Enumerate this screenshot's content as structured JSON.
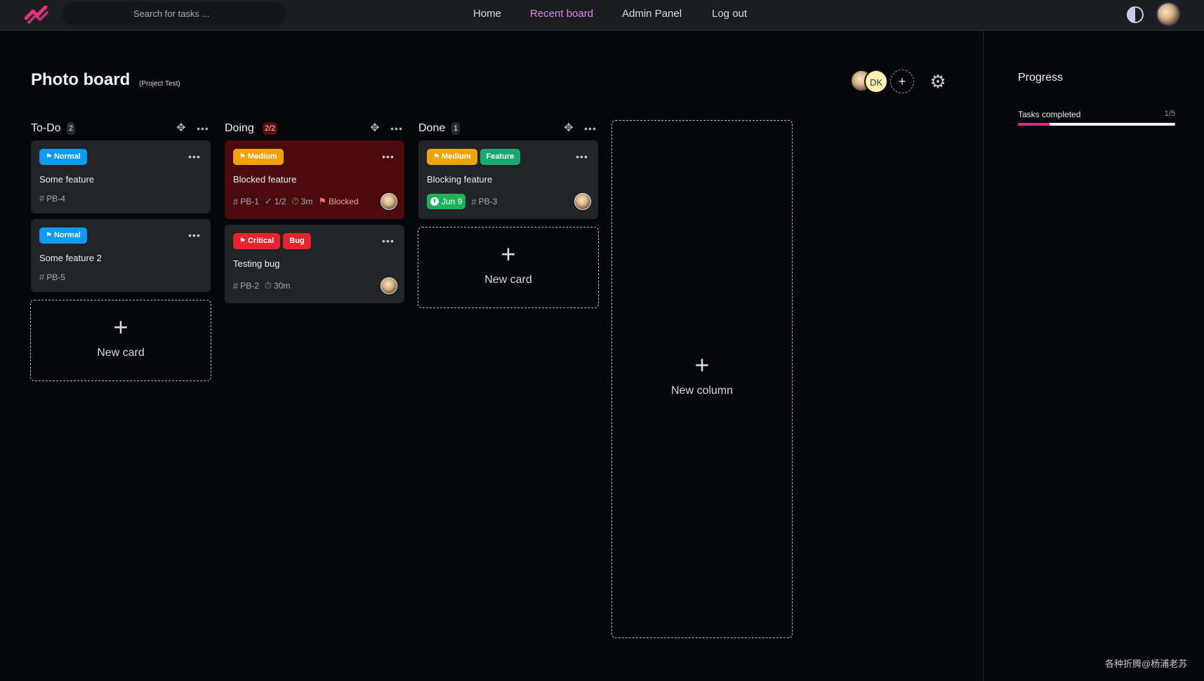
{
  "header": {
    "search_placeholder": "Search for tasks ...",
    "nav": [
      {
        "label": "Home",
        "active": false
      },
      {
        "label": "Recent board",
        "active": true
      },
      {
        "label": "Admin Panel",
        "active": false
      },
      {
        "label": "Log out",
        "active": false
      }
    ]
  },
  "board": {
    "title": "Photo board",
    "subtitle": "(Project Test)",
    "members": [
      "photo",
      "DK"
    ],
    "member_initials": "DK",
    "add_member": "+"
  },
  "columns": [
    {
      "title": "To-Do",
      "count": "2",
      "cards": [
        {
          "tags": [
            {
              "label": "Normal",
              "color": "#0d9bef",
              "icon": "flag-icon"
            }
          ],
          "title": "Some feature",
          "id": "PB-4"
        },
        {
          "tags": [
            {
              "label": "Normal",
              "color": "#0d9bef",
              "icon": "flag-icon"
            }
          ],
          "title": "Some feature 2",
          "id": "PB-5"
        }
      ],
      "new_card": "New card"
    },
    {
      "title": "Doing",
      "count": "2/2",
      "cards": [
        {
          "tags": [
            {
              "label": "Medium",
              "color": "#f0a20a",
              "icon": "flag-icon"
            }
          ],
          "title": "Blocked feature",
          "id": "PB-1",
          "checklist": "1/2",
          "time": "3m",
          "status": "Blocked",
          "blocked": true,
          "assignee": "photo-avatar"
        },
        {
          "tags": [
            {
              "label": "Critical",
              "color": "#e8232d",
              "icon": "flag-icon"
            },
            {
              "label": "Bug",
              "color": "#e8232d"
            }
          ],
          "title": "Testing bug",
          "id": "PB-2",
          "time": "30m",
          "assignee": "photo-avatar"
        }
      ]
    },
    {
      "title": "Done",
      "count": "1",
      "cards": [
        {
          "tags": [
            {
              "label": "Medium",
              "color": "#f0a20a",
              "icon": "flag-icon"
            },
            {
              "label": "Feature",
              "color": "#18a870"
            }
          ],
          "title": "Blocking feature",
          "due": "Jun 9",
          "id": "PB-3",
          "assignee": "photo-avatar"
        }
      ],
      "new_card": "New card"
    }
  ],
  "new_column": "New column",
  "sidebar": {
    "title": "Progress",
    "progress_label": "Tasks completed",
    "progress_count": "1/5",
    "progress_fraction": 0.2
  },
  "watermark": "各种折腾@杨浦老苏",
  "colors": {
    "accent": "#d98be8",
    "progress_fill": "#e61f82",
    "blocked_card": "#4b0b0e",
    "due_badge": "#1fb25a"
  }
}
